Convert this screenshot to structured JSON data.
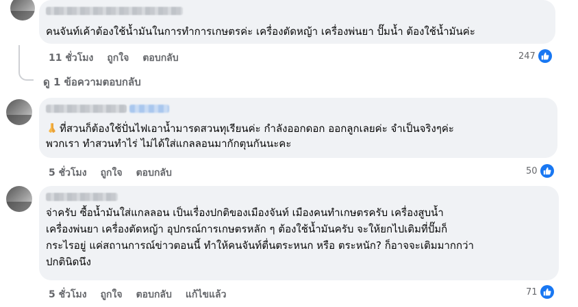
{
  "comments": [
    {
      "text_lines": [
        "คนจันท์เค้าต้องใช้น้ำมันในการทำการเกษตรค่ะ เครื่องตัดหญ้า เครื่องพ่นยา ปั๊มน้ำ ต้องใช้น้ำมันค่ะ"
      ],
      "time": "11 ชั่วโมง",
      "like_label": "ถูกใจ",
      "reply_label": "ตอบกลับ",
      "reaction_count": "247",
      "view_replies": "ดู 1 ข้อความตอบกลับ"
    },
    {
      "text_lines": [
        "ที่สวนก็ต้องใช้ปั่นไฟเอาน้ำมารดสวนทุเรียนค่ะ กำลังออกดอก ออกลูกเลยค่ะ จำเป็นจริงๆค่ะ",
        "พวกเรา ทำสวนทำไร่ ไม่ได้ใส่แกลลอนมากักตุนกันนะคะ"
      ],
      "time": "5 ชั่วโมง",
      "like_label": "ถูกใจ",
      "reply_label": "ตอบกลับ",
      "reaction_count": "50"
    },
    {
      "text_lines": [
        "จ่าครับ ซื้อน้ำมันใส่แกลลอน เป็นเรื่องปกติของเมืองจันท์ เมืองคนทำเกษตรครับ เครื่องสูบน้ำ",
        "เครื่องพ่นยา เครื่องตัดหญ้า อุปกรณ์การเกษตรหลัก ๆ ต้องใช้น้ำมันครับ จะให้ยกไปเติมที่ปั๊มก็",
        "กระไรอยู่ แค่สถานการณ์ข่าวตอนนี้ ทำให้คนจันท์ตื่นตระหนก หรือ ตระหนัก? ก็อาจจะเติมมากกว่า",
        "ปกตินิดนึง"
      ],
      "time": "5 ชั่วโมง",
      "like_label": "ถูกใจ",
      "reply_label": "ตอบกลับ",
      "edited_label": "แก้ไขแล้ว",
      "reaction_count": "71"
    }
  ],
  "icons": {
    "reaction": "thumbs-up-icon",
    "emoji": "folded-hands-icon"
  },
  "colors": {
    "like_blue": "#1877f2",
    "bubble": "#f0f2f5",
    "meta": "#65676b"
  }
}
